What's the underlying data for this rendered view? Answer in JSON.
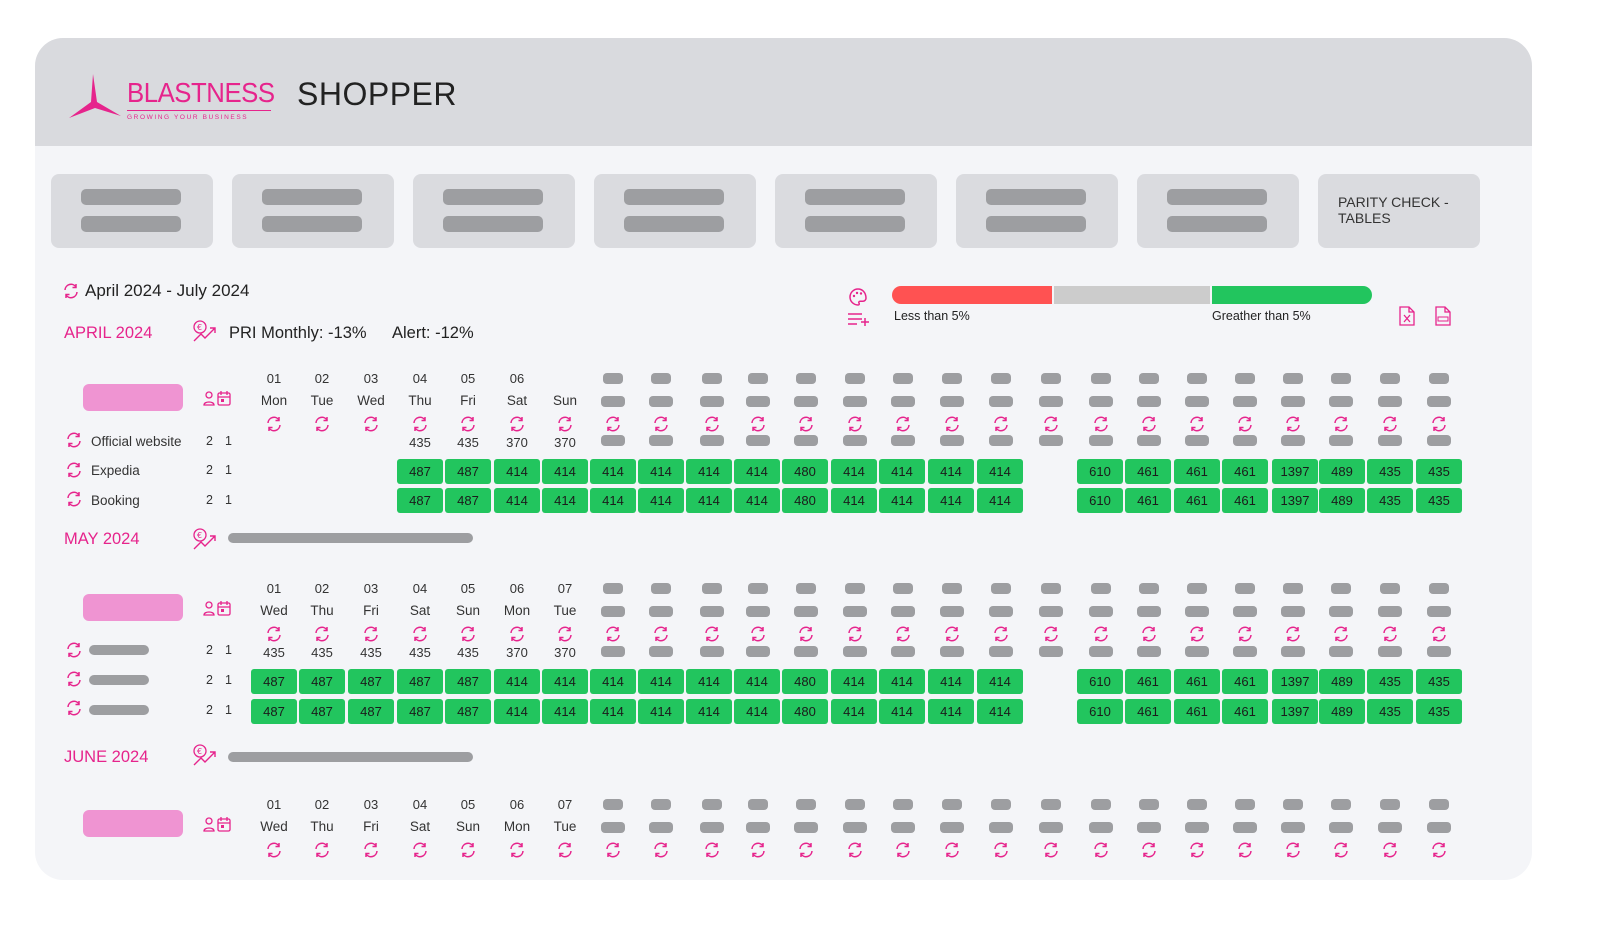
{
  "brand": {
    "name": "BLASTNESS",
    "tagline": "GROWING YOUR BUSINESS",
    "app_title": "SHOPPER",
    "accent": "#e6248c"
  },
  "tabs": {
    "active_label": "PARITY CHECK - TABLES"
  },
  "period": {
    "range": "April 2024 - July 2024"
  },
  "legend": {
    "low_label": "Less than 5%",
    "high_label": "Greather than 5%",
    "low_color": "#ff5252",
    "mid_color": "#cccccc",
    "high_color": "#22c55e"
  },
  "april": {
    "title": "APRIL 2024",
    "pri_label": "PRI Monthly: ",
    "pri_value": "-13%",
    "alert_label": "Alert: ",
    "alert_value": "-12%",
    "days": [
      {
        "num": "01",
        "day": "Mon"
      },
      {
        "num": "02",
        "day": "Tue"
      },
      {
        "num": "03",
        "day": "Wed"
      },
      {
        "num": "04",
        "day": "Thu"
      },
      {
        "num": "05",
        "day": "Fri"
      },
      {
        "num": "06",
        "day": "Sat"
      },
      {
        "num": "",
        "day": "Sun"
      }
    ],
    "channels": [
      {
        "name": "Official website",
        "adults": "2",
        "rooms": "1"
      },
      {
        "name": "Expedia",
        "adults": "2",
        "rooms": "1"
      },
      {
        "name": "Booking",
        "adults": "2",
        "rooms": "1"
      }
    ],
    "official_values": [
      "435",
      "435",
      "370",
      "370"
    ],
    "green_rows": [
      [
        "487",
        "487",
        "414",
        "414",
        "414",
        "414",
        "414",
        "414",
        "480",
        "414",
        "414",
        "414",
        "414",
        "610",
        "461",
        "461",
        "461",
        "1397",
        "489",
        "435",
        "435"
      ],
      [
        "487",
        "487",
        "414",
        "414",
        "414",
        "414",
        "414",
        "414",
        "480",
        "414",
        "414",
        "414",
        "414",
        "610",
        "461",
        "461",
        "461",
        "1397",
        "489",
        "435",
        "435"
      ]
    ]
  },
  "may": {
    "title": "MAY 2024",
    "days": [
      {
        "num": "01",
        "day": "Wed"
      },
      {
        "num": "02",
        "day": "Thu"
      },
      {
        "num": "03",
        "day": "Fri"
      },
      {
        "num": "04",
        "day": "Sat"
      },
      {
        "num": "05",
        "day": "Sun"
      },
      {
        "num": "06",
        "day": "Mon"
      },
      {
        "num": "07",
        "day": "Tue"
      }
    ],
    "channels": [
      {
        "adults": "2",
        "rooms": "1"
      },
      {
        "adults": "2",
        "rooms": "1"
      },
      {
        "adults": "2",
        "rooms": "1"
      }
    ],
    "plain_values": [
      "435",
      "435",
      "435",
      "435",
      "435",
      "370",
      "370"
    ],
    "green_rows": [
      [
        "487",
        "487",
        "487",
        "487",
        "487",
        "414",
        "414",
        "414",
        "414",
        "414",
        "414",
        "480",
        "414",
        "414",
        "414",
        "414",
        "610",
        "461",
        "461",
        "461",
        "1397",
        "489",
        "435",
        "435"
      ],
      [
        "487",
        "487",
        "487",
        "487",
        "487",
        "414",
        "414",
        "414",
        "414",
        "414",
        "414",
        "480",
        "414",
        "414",
        "414",
        "414",
        "610",
        "461",
        "461",
        "461",
        "1397",
        "489",
        "435",
        "435"
      ]
    ]
  },
  "june": {
    "title": "JUNE 2024",
    "days": [
      {
        "num": "01",
        "day": "Wed"
      },
      {
        "num": "02",
        "day": "Thu"
      },
      {
        "num": "03",
        "day": "Fri"
      },
      {
        "num": "04",
        "day": "Sat"
      },
      {
        "num": "05",
        "day": "Sun"
      },
      {
        "num": "06",
        "day": "Mon"
      },
      {
        "num": "07",
        "day": "Tue"
      }
    ]
  },
  "icons": [
    "sync-icon",
    "euro-trend-icon",
    "guest-calendar-icon",
    "palette-icon",
    "add-list-icon",
    "excel-export-icon",
    "csv-export-icon"
  ]
}
